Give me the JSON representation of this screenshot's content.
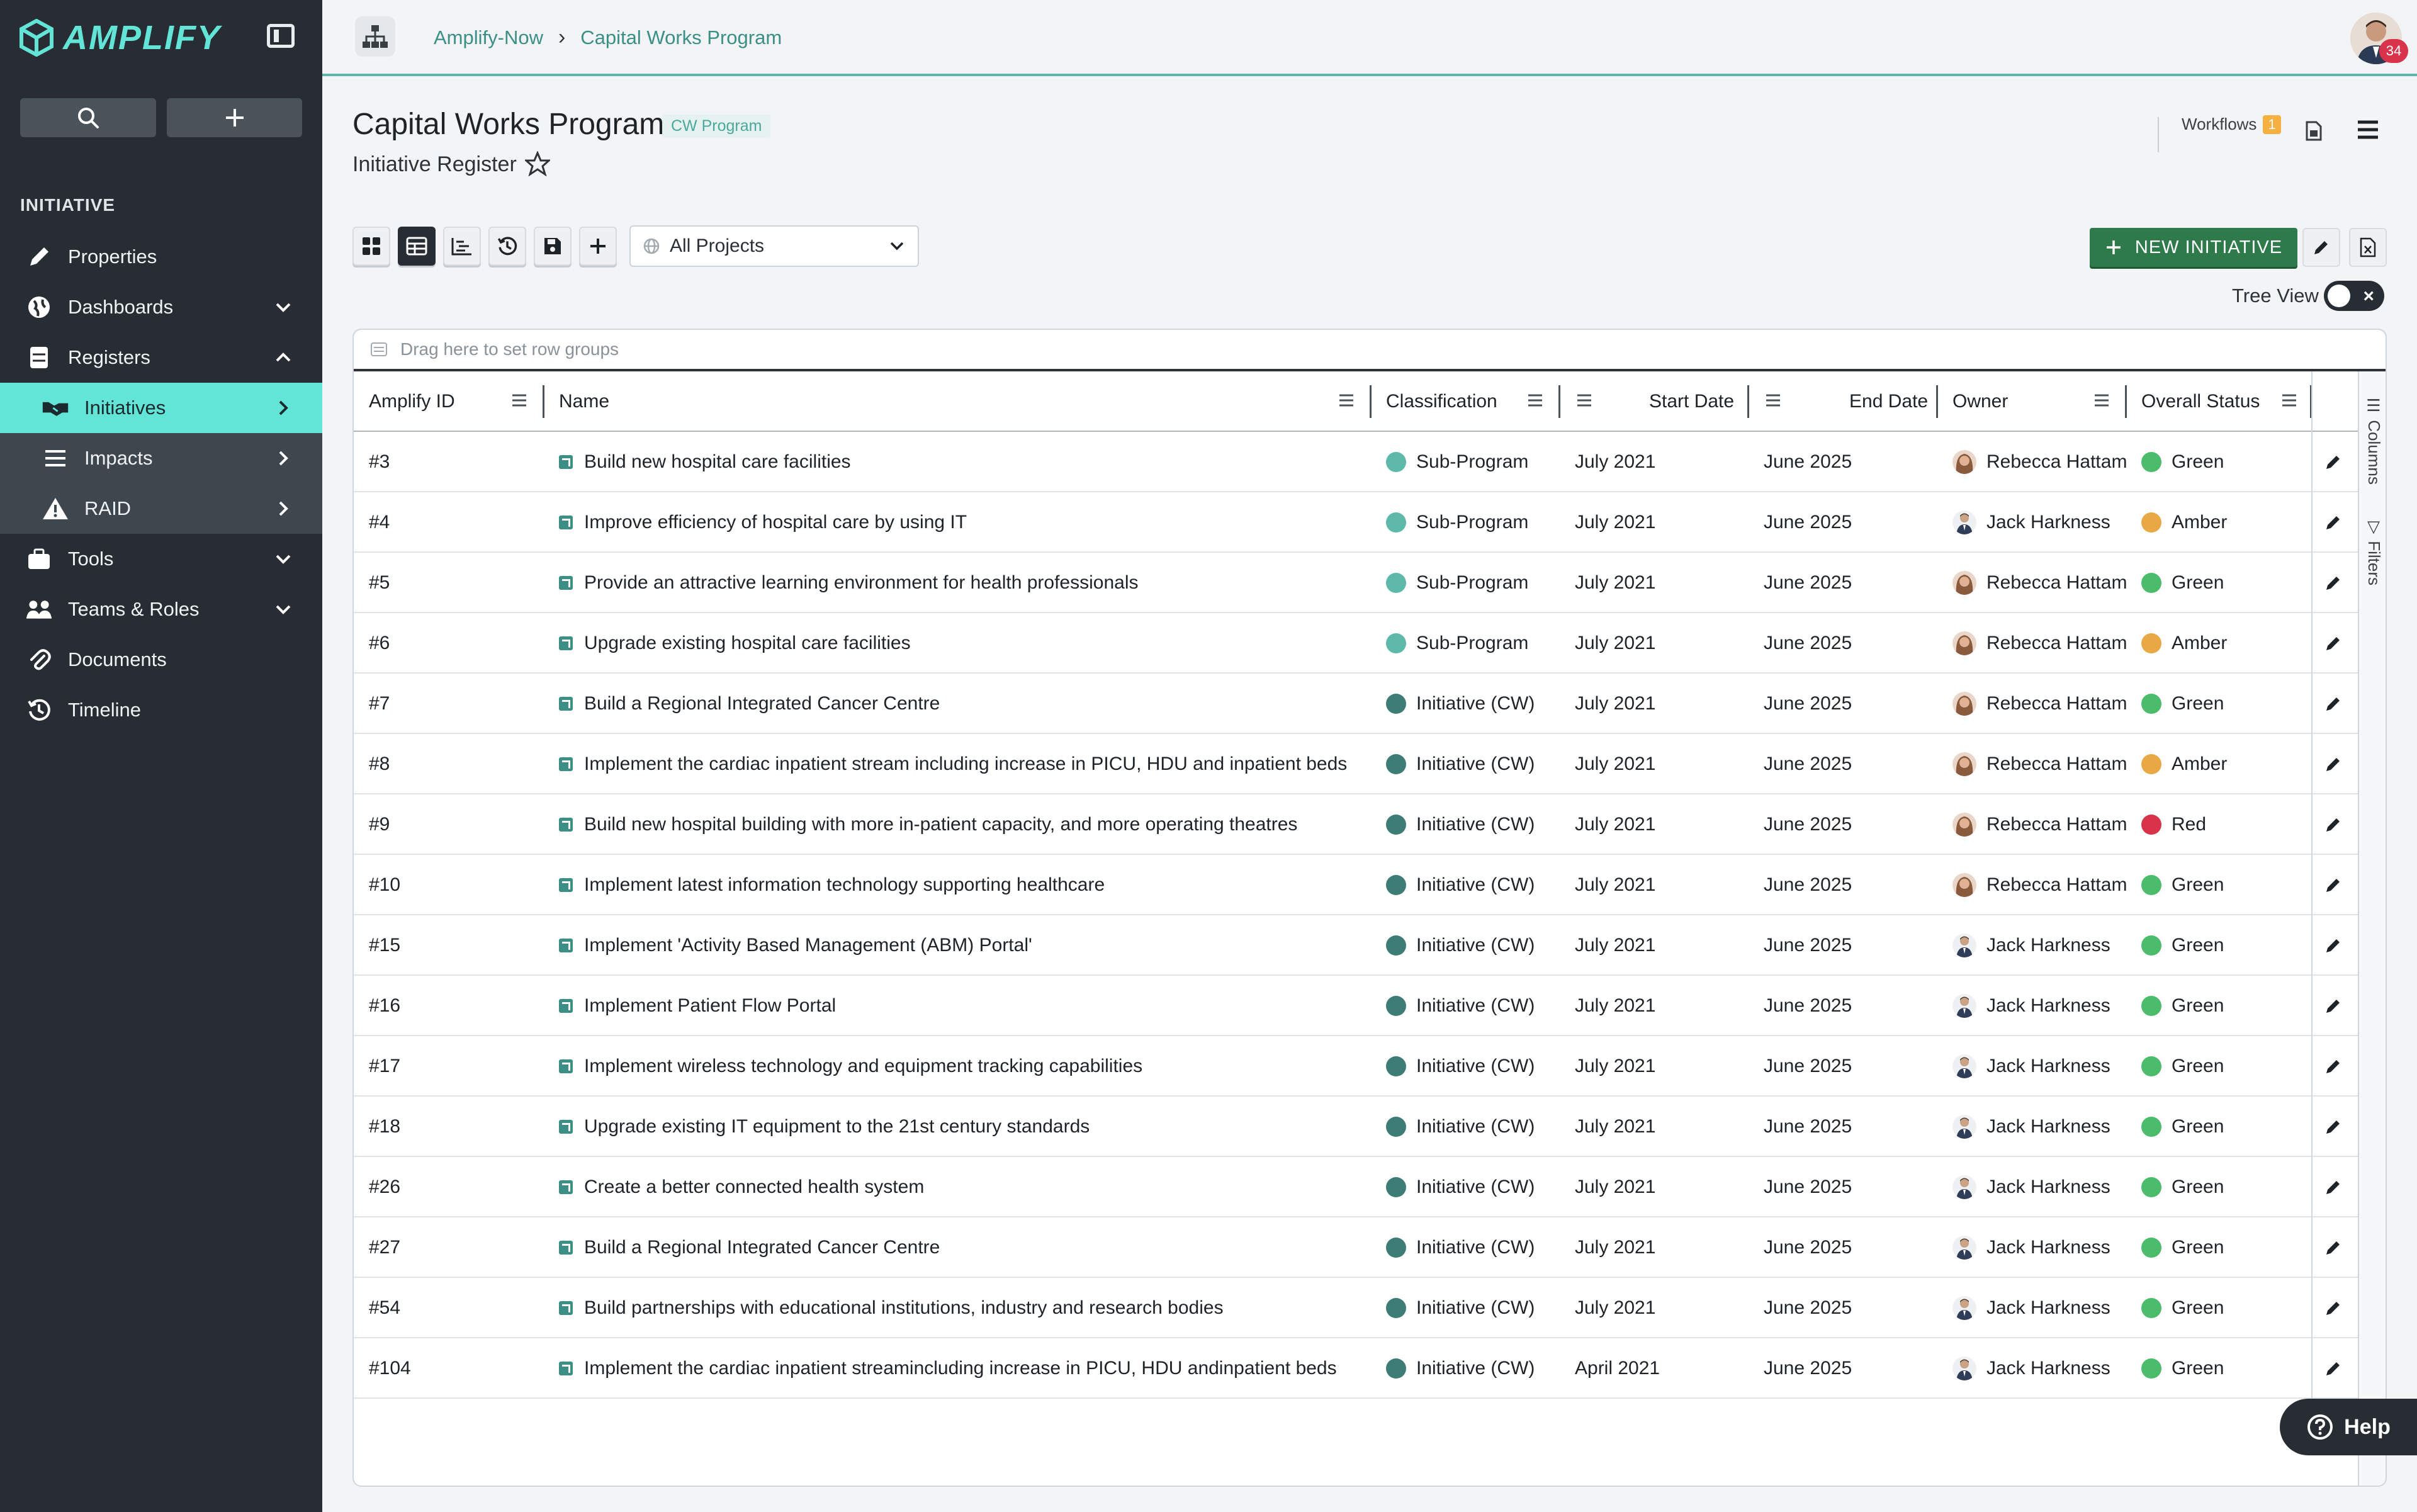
{
  "app": {
    "name": "AMPLIFY"
  },
  "sidebar": {
    "section_label": "INITIATIVE",
    "items": [
      {
        "label": "Properties",
        "icon": "pencil-icon"
      },
      {
        "label": "Dashboards",
        "icon": "globe-icon"
      },
      {
        "label": "Registers",
        "icon": "register-icon"
      },
      {
        "label": "Initiatives",
        "icon": "handshake-icon"
      },
      {
        "label": "Impacts",
        "icon": "list-icon"
      },
      {
        "label": "RAID",
        "icon": "warning-icon"
      },
      {
        "label": "Tools",
        "icon": "toolbox-icon"
      },
      {
        "label": "Teams & Roles",
        "icon": "team-icon"
      },
      {
        "label": "Documents",
        "icon": "paperclip-icon"
      },
      {
        "label": "Timeline",
        "icon": "history-icon"
      }
    ]
  },
  "topbar": {
    "breadcrumb": [
      "Amplify-Now",
      "Capital Works Program"
    ],
    "notification_count": "34"
  },
  "page": {
    "title": "Capital Works Program",
    "tag": "CW Program",
    "subtitle": "Initiative Register",
    "workflows_label": "Workflows",
    "workflows_count": "1"
  },
  "toolbar": {
    "project_select": "All Projects",
    "new_button": "NEW INITIATIVE",
    "tree_view_label": "Tree View"
  },
  "grid": {
    "drag_hint": "Drag here to set row groups",
    "columns": [
      "Amplify ID",
      "Name",
      "Classification",
      "Start Date",
      "End Date",
      "Owner",
      "Overall Status"
    ],
    "side_tabs": [
      "Columns",
      "Filters"
    ],
    "rows": [
      {
        "id": "#3",
        "name": "Build new hospital care facilities",
        "classification": "Sub-Program",
        "start": "July 2021",
        "end": "June 2025",
        "owner": "Rebecca Hattam",
        "status": "Green"
      },
      {
        "id": "#4",
        "name": "Improve efficiency of hospital care by using IT",
        "classification": "Sub-Program",
        "start": "July 2021",
        "end": "June 2025",
        "owner": "Jack Harkness",
        "status": "Amber"
      },
      {
        "id": "#5",
        "name": "Provide an attractive learning environment for health professionals",
        "classification": "Sub-Program",
        "start": "July 2021",
        "end": "June 2025",
        "owner": "Rebecca Hattam",
        "status": "Green"
      },
      {
        "id": "#6",
        "name": "Upgrade existing hospital care facilities",
        "classification": "Sub-Program",
        "start": "July 2021",
        "end": "June 2025",
        "owner": "Rebecca Hattam",
        "status": "Amber"
      },
      {
        "id": "#7",
        "name": "Build a Regional Integrated Cancer Centre",
        "classification": "Initiative (CW)",
        "start": "July 2021",
        "end": "June 2025",
        "owner": "Rebecca Hattam",
        "status": "Green"
      },
      {
        "id": "#8",
        "name": "Implement the cardiac inpatient stream including increase in PICU, HDU and inpatient beds",
        "classification": "Initiative (CW)",
        "start": "July 2021",
        "end": "June 2025",
        "owner": "Rebecca Hattam",
        "status": "Amber"
      },
      {
        "id": "#9",
        "name": "Build new hospital building with more in-patient capacity, and more operating theatres",
        "classification": "Initiative (CW)",
        "start": "July 2021",
        "end": "June 2025",
        "owner": "Rebecca Hattam",
        "status": "Red"
      },
      {
        "id": "#10",
        "name": "Implement latest information technology supporting healthcare",
        "classification": "Initiative (CW)",
        "start": "July 2021",
        "end": "June 2025",
        "owner": "Rebecca Hattam",
        "status": "Green"
      },
      {
        "id": "#15",
        "name": "Implement 'Activity Based Management (ABM) Portal'",
        "classification": "Initiative (CW)",
        "start": "July 2021",
        "end": "June 2025",
        "owner": "Jack Harkness",
        "status": "Green"
      },
      {
        "id": "#16",
        "name": "Implement Patient Flow Portal",
        "classification": "Initiative (CW)",
        "start": "July 2021",
        "end": "June 2025",
        "owner": "Jack Harkness",
        "status": "Green"
      },
      {
        "id": "#17",
        "name": "Implement wireless technology and equipment tracking capabilities",
        "classification": "Initiative (CW)",
        "start": "July 2021",
        "end": "June 2025",
        "owner": "Jack Harkness",
        "status": "Green"
      },
      {
        "id": "#18",
        "name": "Upgrade existing IT equipment to the 21st century standards",
        "classification": "Initiative (CW)",
        "start": "July 2021",
        "end": "June 2025",
        "owner": "Jack Harkness",
        "status": "Green"
      },
      {
        "id": "#26",
        "name": "Create a better connected health system",
        "classification": "Initiative (CW)",
        "start": "July 2021",
        "end": "June 2025",
        "owner": "Jack Harkness",
        "status": "Green"
      },
      {
        "id": "#27",
        "name": "Build a Regional Integrated Cancer Centre",
        "classification": "Initiative (CW)",
        "start": "July 2021",
        "end": "June 2025",
        "owner": "Jack Harkness",
        "status": "Green"
      },
      {
        "id": "#54",
        "name": "Build partnerships with educational institutions, industry and research bodies",
        "classification": "Initiative (CW)",
        "start": "July 2021",
        "end": "June 2025",
        "owner": "Jack Harkness",
        "status": "Green"
      },
      {
        "id": "#104",
        "name": "Implement the cardiac inpatient streamincluding increase in PICU, HDU andinpatient beds",
        "classification": "Initiative (CW)",
        "start": "April 2021",
        "end": "June 2025",
        "owner": "Jack Harkness",
        "status": "Green"
      }
    ]
  },
  "help_label": "Help",
  "colors": {
    "accent": "#62e4d6",
    "sidebar_bg": "#272d33",
    "status_green": "#4cbb6c",
    "status_amber": "#e8a845",
    "status_red": "#d8334a",
    "class_subprogram": "#5fb9ab",
    "class_initiative": "#3d7d76",
    "primary_button": "#2f7a4a"
  }
}
